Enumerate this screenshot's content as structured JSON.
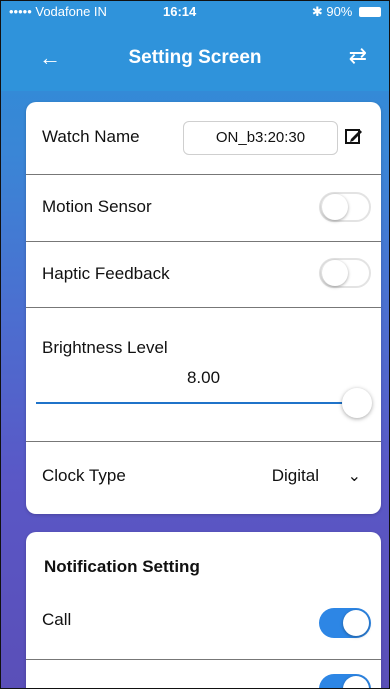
{
  "status_bar": {
    "carrier": "••••• Vodafone IN",
    "time": "16:14",
    "battery": "90%"
  },
  "nav": {
    "title": "Setting Screen"
  },
  "settings": {
    "watch_name": {
      "label": "Watch Name",
      "value": "ON_b3:20:30"
    },
    "motion_sensor": {
      "label": "Motion Sensor",
      "enabled": false
    },
    "haptic_feedback": {
      "label": "Haptic Feedback",
      "enabled": false
    },
    "brightness": {
      "label": "Brightness Level",
      "value": "8.00",
      "fraction": 1.0
    },
    "clock_type": {
      "label": "Clock Type",
      "value": "Digital"
    }
  },
  "notification": {
    "title": "Notification Setting",
    "call": {
      "label": "Call",
      "enabled": true
    }
  },
  "colors": {
    "accent": "#2d86e5",
    "nav": "#2f93db"
  },
  "icons": [
    "back-arrow-icon",
    "share-icon",
    "edit-icon",
    "chevron-down-icon",
    "wifi-icon",
    "bluetooth-icon",
    "battery-icon"
  ]
}
